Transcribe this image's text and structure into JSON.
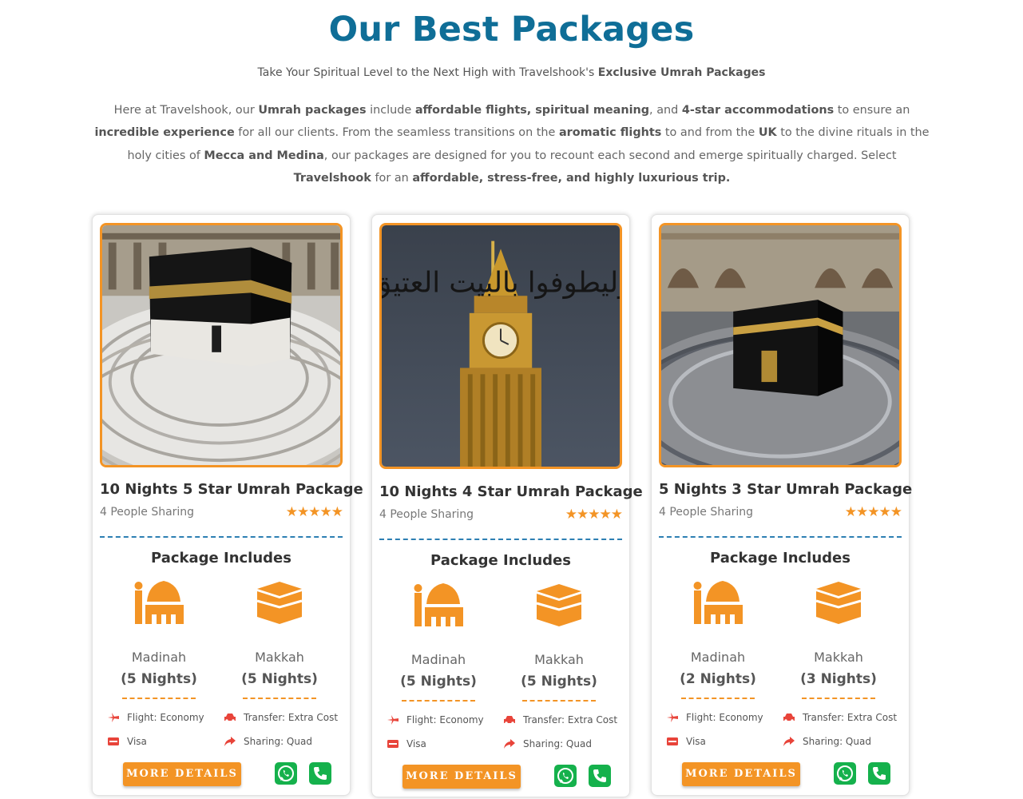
{
  "header": {
    "title": "Our Best Packages",
    "subtitle_plain": "Take Your Spiritual Level to the Next High with Travelshook's",
    "subtitle_bold": "Exclusive Umrah Packages"
  },
  "intro": {
    "p1": "Here at Travelshook, our ",
    "b1": "Umrah packages",
    "p2": " include ",
    "b2": "affordable flights, spiritual meaning",
    "p3": ", and ",
    "b3": "4-star accommodations",
    "p4": " to ensure an ",
    "b4": "incredible experience",
    "p5": " for all our clients. From the seamless transitions on the ",
    "b5": "aromatic flights",
    "p6": " to and from the ",
    "b6": "UK",
    "p7": " to the divine rituals in the holy cities of ",
    "b7": "Mecca and Medina",
    "p8": ", our packages are designed for you to recount each second and emerge spiritually charged. Select ",
    "b8": "Travelshook",
    "p9": " for an ",
    "b9": "affordable, stress-free, and highly luxurious trip."
  },
  "colors": {
    "accent": "#f39425",
    "title_blue": "#0f6e97",
    "divider_blue": "#2d7fb3",
    "whatsapp_green": "#15b14c"
  },
  "cards": [
    {
      "name": "10 Nights 5 Star Umrah Package",
      "sharing": "4 People Sharing",
      "stars": "★★★★★",
      "includes_title": "Package Includes",
      "madinah": {
        "label": "Madinah",
        "nights": "(5 Nights)",
        "icon": "mosque-icon"
      },
      "makkah": {
        "label": "Makkah",
        "nights": "(5 Nights)",
        "icon": "kaaba-icon"
      },
      "flight": "Flight: Economy",
      "transfer": "Transfer: Extra Cost",
      "visa": "Visa",
      "share_type": "Sharing: Quad",
      "button": "MORE DETAILS",
      "image": "kaaba-crowd-photo"
    },
    {
      "name": "10 Nights 4 Star Umrah Package",
      "sharing": "4 People Sharing",
      "stars": "★★★★★",
      "includes_title": "Package Includes",
      "madinah": {
        "label": "Madinah",
        "nights": "(5 Nights)",
        "icon": "mosque-icon"
      },
      "makkah": {
        "label": "Makkah",
        "nights": "(5 Nights)",
        "icon": "kaaba-icon"
      },
      "flight": "Flight: Economy",
      "transfer": "Transfer: Extra Cost",
      "visa": "Visa",
      "share_type": "Sharing: Quad",
      "button": "MORE DETAILS",
      "image": "clock-tower-photo",
      "calligraphy": "وليطوفوا بالبيت العتيق"
    },
    {
      "name": "5 Nights 3 Star Umrah Package",
      "sharing": "4 People Sharing",
      "stars": "★★★★★",
      "includes_title": "Package Includes",
      "madinah": {
        "label": "Madinah",
        "nights": "(2 Nights)",
        "icon": "mosque-icon"
      },
      "makkah": {
        "label": "Makkah",
        "nights": "(3 Nights)",
        "icon": "kaaba-icon"
      },
      "flight": "Flight: Economy",
      "transfer": "Transfer: Extra Cost",
      "visa": "Visa",
      "share_type": "Sharing: Quad",
      "button": "MORE DETAILS",
      "image": "kaaba-night-photo"
    }
  ]
}
